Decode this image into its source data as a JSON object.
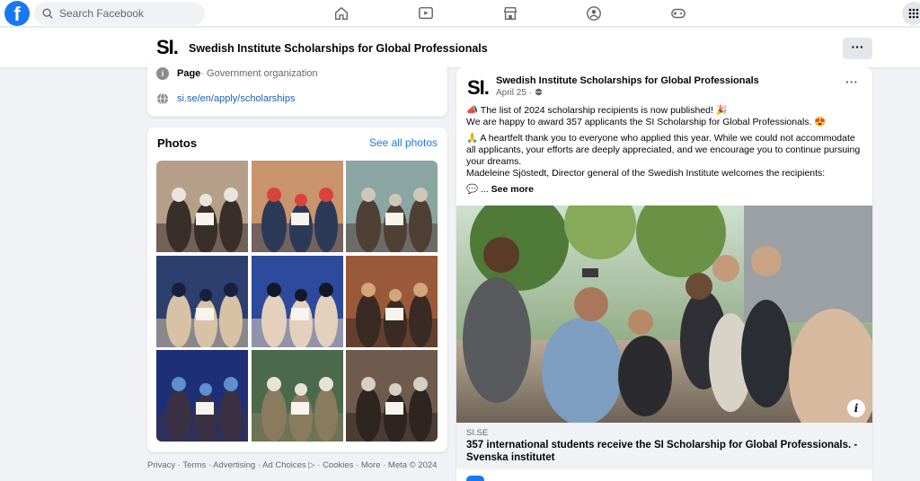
{
  "topbar": {
    "logo": "f",
    "search_placeholder": "Search Facebook",
    "nav": [
      "home-icon",
      "watch-icon",
      "marketplace-icon",
      "groups-icon",
      "gaming-icon"
    ],
    "menu": "grid-icon"
  },
  "page": {
    "logo": "SI.",
    "name": "Swedish Institute Scholarships for Global Professionals",
    "more": "···"
  },
  "intro": {
    "category_label": "Page",
    "category_value": " · Government organization",
    "website": "si.se/en/apply/scholarships"
  },
  "photos": {
    "title": "Photos",
    "see_all": "See all photos",
    "items": [
      {
        "name": "photo-1",
        "palette": [
          "#b59f88",
          "#3a2e2a",
          "#e9e4de"
        ]
      },
      {
        "name": "photo-2",
        "palette": [
          "#c9946b",
          "#2c3a57",
          "#d9443a"
        ]
      },
      {
        "name": "photo-3",
        "palette": [
          "#8ba5a3",
          "#4f3f35",
          "#cfc7b6"
        ]
      },
      {
        "name": "photo-4",
        "palette": [
          "#2c3f6e",
          "#d8c2a6",
          "#17213e"
        ]
      },
      {
        "name": "photo-5",
        "palette": [
          "#2d4a9c",
          "#e4d0bc",
          "#121826"
        ]
      },
      {
        "name": "photo-6",
        "palette": [
          "#9a5a3a",
          "#3a2a24",
          "#d1a67a"
        ]
      },
      {
        "name": "photo-7",
        "palette": [
          "#1e2f7a",
          "#3a3044",
          "#5e8fd1"
        ]
      },
      {
        "name": "photo-8",
        "palette": [
          "#4b6a4c",
          "#8a7b5e",
          "#e8e2d4"
        ]
      },
      {
        "name": "photo-9",
        "palette": [
          "#6f5b4d",
          "#2e2420",
          "#d8cfc4"
        ]
      }
    ]
  },
  "footer": "Privacy · Terms · Advertising · Ad Choices ▷ · Cookies · More · Meta © 2024",
  "post": {
    "logo": "SI.",
    "name": "Swedish Institute Scholarships for Global Professionals",
    "date": "April 25 · ",
    "more": "···",
    "lines": [
      "📣 The list of 2024 scholarship recipients is now published! 🎉",
      "We are happy to award 357 applicants the SI Scholarship for Global Professionals. 😍",
      "🙏 A heartfelt thank you to everyone who applied this year. While we could not accommodate all applicants, your efforts are deeply appreciated, and we encourage you to continue pursuing your dreams.",
      "Madeleine Sjöstedt, Director general of the Swedish Institute welcomes the recipients:",
      "💬 ... "
    ],
    "see_more": "See more",
    "info": "i",
    "link_domain": "SI.SE",
    "link_title": "357 international students receive the SI Scholarship for Global Professionals. - Svenska institutet"
  },
  "colors": {
    "brand": "#1877f2",
    "link": "#1b5fbf",
    "background": "#f0f2f5"
  }
}
